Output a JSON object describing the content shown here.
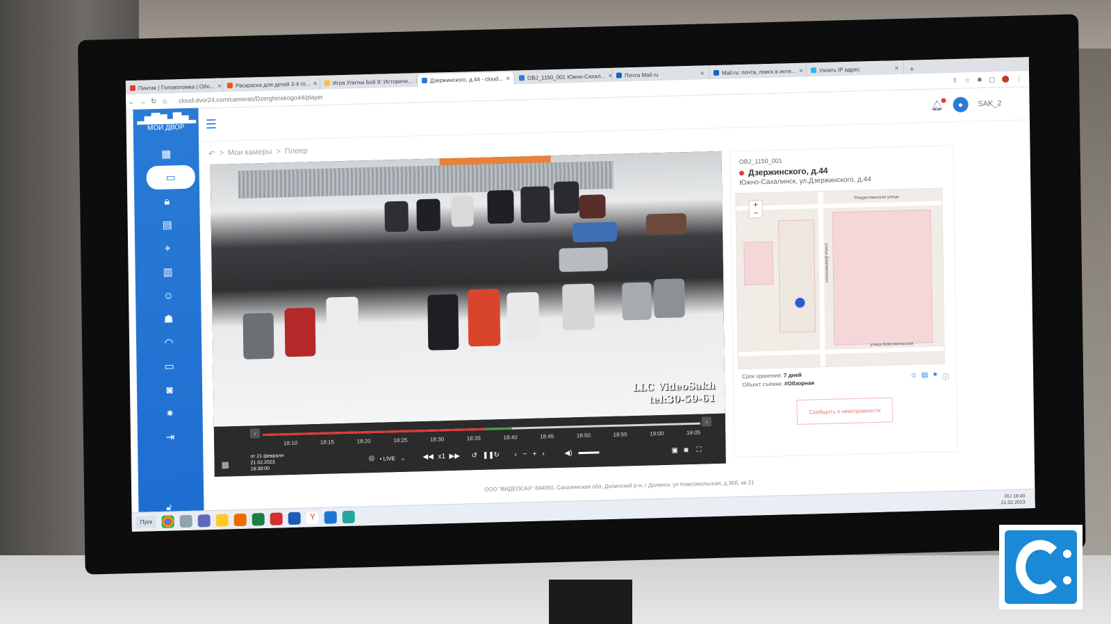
{
  "browser": {
    "tabs": [
      {
        "title": "Пинтак | Головоломка | Обо...",
        "color": "#e53935"
      },
      {
        "title": "Раскраска для детей 3-4 го...",
        "color": "#f4511e"
      },
      {
        "title": "Игра Улитка Боб 8: Историче...",
        "color": "#fbc02d"
      },
      {
        "title": "Дзержинского, д.44 - cloud...",
        "color": "#2a7bd6",
        "active": true
      },
      {
        "title": "OBJ_1150_001 Южно-Сахал...",
        "color": "#2a7bd6"
      },
      {
        "title": "Почта Mail.ru",
        "color": "#1565c0"
      },
      {
        "title": "Mail.ru: почта, поиск в инте...",
        "color": "#1565c0"
      },
      {
        "title": "Узнать IP адрес",
        "color": "#29b6f6"
      }
    ],
    "url": "cloud.dvor24.com/cameras/Dzerghinskogo44/player"
  },
  "app": {
    "logo_text": "МОЙ ДВОР",
    "username": "SAK_2",
    "breadcrumb": {
      "home": "Мои камеры",
      "current": "Плеер",
      "sep": ">"
    }
  },
  "player": {
    "overlay_line1": "LLC VideoSakh",
    "overlay_line2": "tel:30-59-61",
    "ticks": [
      "18:10",
      "18:15",
      "18:20",
      "18:25",
      "18:30",
      "18:35",
      "18:40",
      "18:45",
      "18:50",
      "18:55",
      "19:00",
      "19:05"
    ],
    "date_from": "от 21 февраля",
    "date": "21.02.2023",
    "time": "18:38:00",
    "live_label": "• LIVE",
    "speed": "x1",
    "progress_fraction": 0.51
  },
  "panel": {
    "camera_id": "OBJ_1150_001",
    "title": "Дзержинского, д.44",
    "address": "Южно-Сахалинск, ул.Дзержинского, д.44",
    "storage_label": "Срок хранения:",
    "storage_value": "7 дней",
    "object_label": "Объект съёмки:",
    "object_value": "#Обзорная",
    "report_button": "Сообщить о неисправности",
    "map_street1": "Рождественская улица",
    "map_street2": "улица Комсомольская",
    "map_street3": "улица Дзержинского"
  },
  "footer": "ООО \"ВИДЕОСАХ\" 694050, Сахалинская обл, Долинский р-н, г Долинск, ул Комсомольская, д 36б, кв 21",
  "taskbar": {
    "start": "Пуск",
    "tray_lang": "RU",
    "tray_time": "18:40",
    "tray_date": "21.02.2023"
  },
  "colors": {
    "sidebar": "#2a7bd6",
    "accent_red": "#e53935",
    "timeline_red": "#e53935",
    "timeline_green": "#43a047"
  }
}
